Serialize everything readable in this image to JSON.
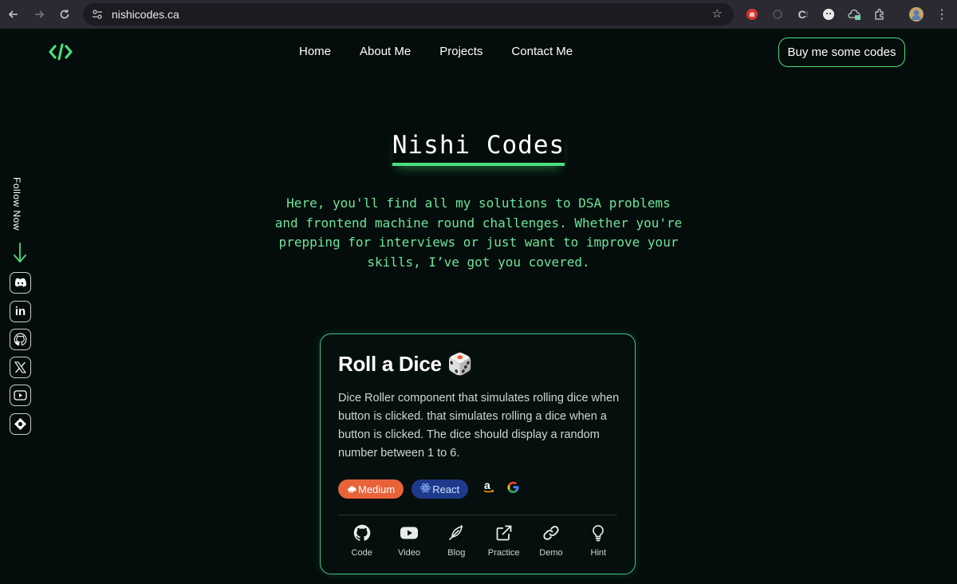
{
  "browser": {
    "url": "nishicodes.ca"
  },
  "nav": {
    "links": [
      "Home",
      "About Me",
      "Projects",
      "Contact Me"
    ],
    "cta": "Buy me some codes"
  },
  "hero": {
    "title": "Nishi Codes",
    "description": "Here, you'll find all my solutions to DSA problems and frontend machine round challenges. Whether you're prepping for interviews or just want to improve your skills, I’ve got you covered."
  },
  "sidebar": {
    "follow_label": "Follow Now",
    "socials": [
      "discord-icon",
      "linkedin-icon",
      "github-icon",
      "x-icon",
      "youtube-icon",
      "hashnode-icon"
    ]
  },
  "card": {
    "title": "Roll a Dice 🎲",
    "description": "Dice Roller component that simulates rolling dice when button is clicked. that simulates rolling a dice when a button is clicked. The dice should display a random number between 1 to 6.",
    "difficulty": "Medium",
    "tech": "React",
    "companies": [
      "amazon-icon",
      "google-icon"
    ],
    "actions": [
      {
        "label": "Code",
        "icon": "github-icon"
      },
      {
        "label": "Video",
        "icon": "youtube-icon"
      },
      {
        "label": "Blog",
        "icon": "quill-icon"
      },
      {
        "label": "Practice",
        "icon": "external-link-icon"
      },
      {
        "label": "Demo",
        "icon": "link-icon"
      },
      {
        "label": "Hint",
        "icon": "lightbulb-icon"
      }
    ]
  },
  "colors": {
    "accent": "#4ade80",
    "background": "#040d0b",
    "medium_tag": "#e8633a",
    "react_tag": "#1f3a8a"
  }
}
